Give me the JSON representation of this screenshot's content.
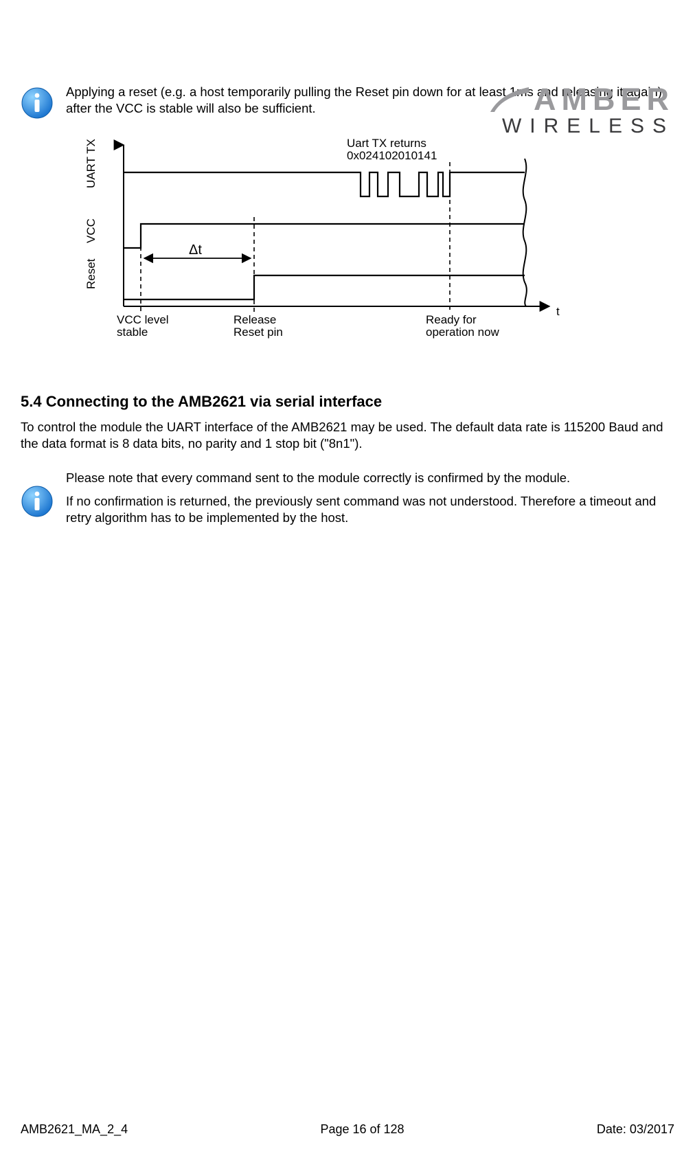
{
  "logo": {
    "line1": "AMBER",
    "line2": "WIRELESS"
  },
  "callout1": {
    "text": "Applying a reset (e.g. a host temporarily pulling the Reset pin down for at least 1ms and releasing it again) after the VCC is stable will also be sufficient."
  },
  "section": {
    "heading": "5.4 Connecting to the AMB2621 via serial interface",
    "paragraph": "To control the module the UART interface of the AMB2621 may be used. The default data rate is 115200 Baud and the data format is 8 data bits, no parity and 1 stop bit (\"8n1\")."
  },
  "callout2": {
    "p1": "Please note that every command sent to the module correctly is confirmed by the module.",
    "p2": "If no confirmation is returned, the previously sent command was not understood. Therefore a timeout and retry algorithm has to be implemented by the host."
  },
  "footer": {
    "left": "AMB2621_MA_2_4",
    "center": "Page 16 of 128",
    "right": "Date: 03/2017"
  },
  "chart_data": {
    "type": "timing-diagram",
    "signals": [
      "Reset",
      "VCC",
      "UART TX"
    ],
    "events": [
      {
        "label": "VCC level stable",
        "signal": "VCC"
      },
      {
        "label": "Release Reset pin",
        "signal": "Reset"
      },
      {
        "label": "Ready for operation now",
        "signal": "UART TX"
      }
    ],
    "annotations": {
      "delta_t": "Δt",
      "uart_burst_label": "Uart TX returns 0x024102010141",
      "x_axis": "t"
    }
  }
}
